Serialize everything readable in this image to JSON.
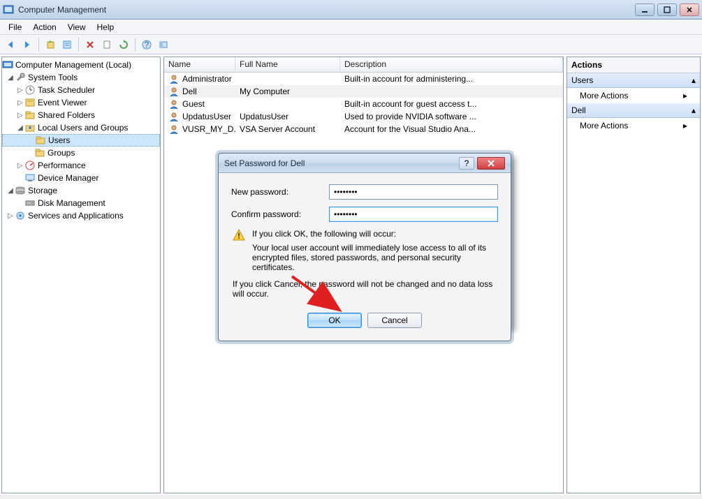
{
  "window": {
    "title": "Computer Management"
  },
  "menu": {
    "file": "File",
    "action": "Action",
    "view": "View",
    "help": "Help"
  },
  "tree": {
    "root": "Computer Management (Local)",
    "system_tools": "System Tools",
    "task_scheduler": "Task Scheduler",
    "event_viewer": "Event Viewer",
    "shared_folders": "Shared Folders",
    "local_users": "Local Users and Groups",
    "users": "Users",
    "groups": "Groups",
    "performance": "Performance",
    "device_manager": "Device Manager",
    "storage": "Storage",
    "disk_management": "Disk Management",
    "services_apps": "Services and Applications"
  },
  "list": {
    "headers": {
      "name": "Name",
      "fullname": "Full Name",
      "description": "Description"
    },
    "rows": [
      {
        "name": "Administrator",
        "fullname": "",
        "description": "Built-in account for administering..."
      },
      {
        "name": "Dell",
        "fullname": "My Computer",
        "description": ""
      },
      {
        "name": "Guest",
        "fullname": "",
        "description": "Built-in account for guest access t..."
      },
      {
        "name": "UpdatusUser",
        "fullname": "UpdatusUser",
        "description": "Used to provide NVIDIA software ..."
      },
      {
        "name": "VUSR_MY_D...",
        "fullname": "VSA Server Account",
        "description": "Account for the Visual Studio Ana..."
      }
    ]
  },
  "actions": {
    "title": "Actions",
    "group1": "Users",
    "more1": "More Actions",
    "group2": "Dell",
    "more2": "More Actions"
  },
  "dialog": {
    "title": "Set Password for Dell",
    "new_label": "New password:",
    "confirm_label": "Confirm password:",
    "new_value": "••••••••",
    "confirm_value": "••••••••",
    "warn_head": "If you click OK, the following will occur:",
    "warn_body": "Your local user account will immediately lose access to all of its encrypted files, stored passwords, and personal security certificates.",
    "cancel_note": "If you click Cancel, the password will not be changed and no data loss will occur.",
    "ok": "OK",
    "cancel": "Cancel",
    "help": "?"
  }
}
